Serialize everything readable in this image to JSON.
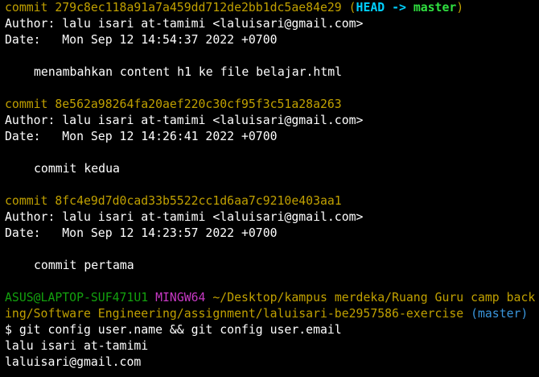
{
  "commits": [
    {
      "hash": "279c8ec118a91a7a459dd712de2bb1dc5ae84e29",
      "refs": {
        "open": " (",
        "head": "HEAD -> ",
        "branch": "master",
        "close": ")"
      },
      "author_line": "Author: lalu isari at-tamimi <laluisari@gmail.com>",
      "date_line": "Date:   Mon Sep 12 14:54:37 2022 +0700",
      "message": "menambahkan content h1 ke file belajar.html"
    },
    {
      "hash": "8e562a98264fa20aef220c30cf95f3c51a28a263",
      "author_line": "Author: lalu isari at-tamimi <laluisari@gmail.com>",
      "date_line": "Date:   Mon Sep 12 14:26:41 2022 +0700",
      "message": "commit kedua"
    },
    {
      "hash": "8fc4e9d7d0cad33b5522cc1d6aa7c9210e403aa1",
      "author_line": "Author: lalu isari at-tamimi <laluisari@gmail.com>",
      "date_line": "Date:   Mon Sep 12 14:23:57 2022 +0700",
      "message": "commit pertama"
    }
  ],
  "commit_word": "commit ",
  "prompt": {
    "user_host": "ASUS@LAPTOP-SUF471U1",
    "shell": "MINGW64",
    "path_line1": "~/Desktop/kampus merdeka/Ruang Guru camp back",
    "path_line2": "ing/Software Engineering/assignment/laluisari-be2957586-exercise",
    "branch": "(master)"
  },
  "command": "$ git config user.name && git config user.email",
  "output": [
    "lalu isari at-tamimi",
    "laluisari@gmail.com"
  ],
  "colors": {
    "background": "#000000",
    "commit_hash": "#c0a000",
    "head_ref": "#00d0ff",
    "branch_ref": "#30e040",
    "user_host": "#13a10e",
    "shell": "#c839c5",
    "path": "#c0a000",
    "branch_prompt": "#3a96dd"
  }
}
